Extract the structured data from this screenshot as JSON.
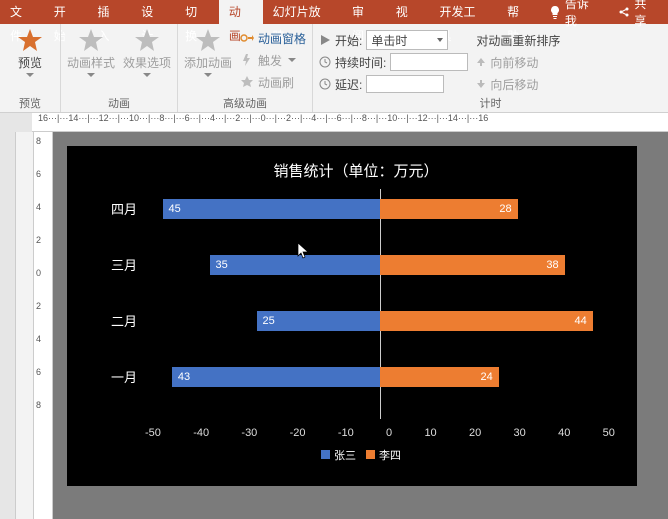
{
  "tabs": {
    "file": "文件",
    "home": "开始",
    "insert": "插入",
    "design": "设计",
    "transitions": "切换",
    "animations": "动画",
    "slideshow": "幻灯片放映",
    "review": "审阅",
    "view": "视图",
    "developer": "开发工具",
    "help": "帮助",
    "tellme": "告诉我",
    "share": "共享"
  },
  "ribbon": {
    "preview": {
      "btn": "预览",
      "group": "预览"
    },
    "anim": {
      "styles": "动画样式",
      "effect": "效果选项",
      "group": "动画"
    },
    "advanced": {
      "add": "添加动画",
      "pane": "动画窗格",
      "trigger": "触发",
      "painter": "动画刷",
      "group": "高级动画"
    },
    "timing": {
      "start_lbl": "开始:",
      "start_val": "单击时",
      "duration_lbl": "持续时间:",
      "duration_val": "",
      "delay_lbl": "延迟:",
      "delay_val": "",
      "reorder": "对动画重新排序",
      "fwd": "向前移动",
      "back": "向后移动",
      "group": "计时"
    }
  },
  "ruler_h": "16···|···14···|···12···|···10···|···8···|···6···|···4···|···2···|···0···|···2···|···4···|···6···|···8···|···10···|···12···|···14···|···16",
  "ruler_v": [
    "8",
    "6",
    "4",
    "2",
    "0",
    "2",
    "4",
    "6",
    "8"
  ],
  "chart_data": {
    "type": "bar",
    "orientation": "horizontal",
    "title": "销售统计（单位：万元）",
    "categories": [
      "四月",
      "三月",
      "二月",
      "一月"
    ],
    "series": [
      {
        "name": "张三",
        "color": "#4472c4",
        "values": [
          -45,
          -35,
          -25,
          -43
        ]
      },
      {
        "name": "李四",
        "color": "#ed7d31",
        "values": [
          28,
          38,
          44,
          24
        ]
      }
    ],
    "xlim": [
      -50,
      50
    ],
    "xticks": [
      -50,
      -40,
      -30,
      -20,
      -10,
      0,
      10,
      20,
      30,
      40,
      50
    ]
  }
}
